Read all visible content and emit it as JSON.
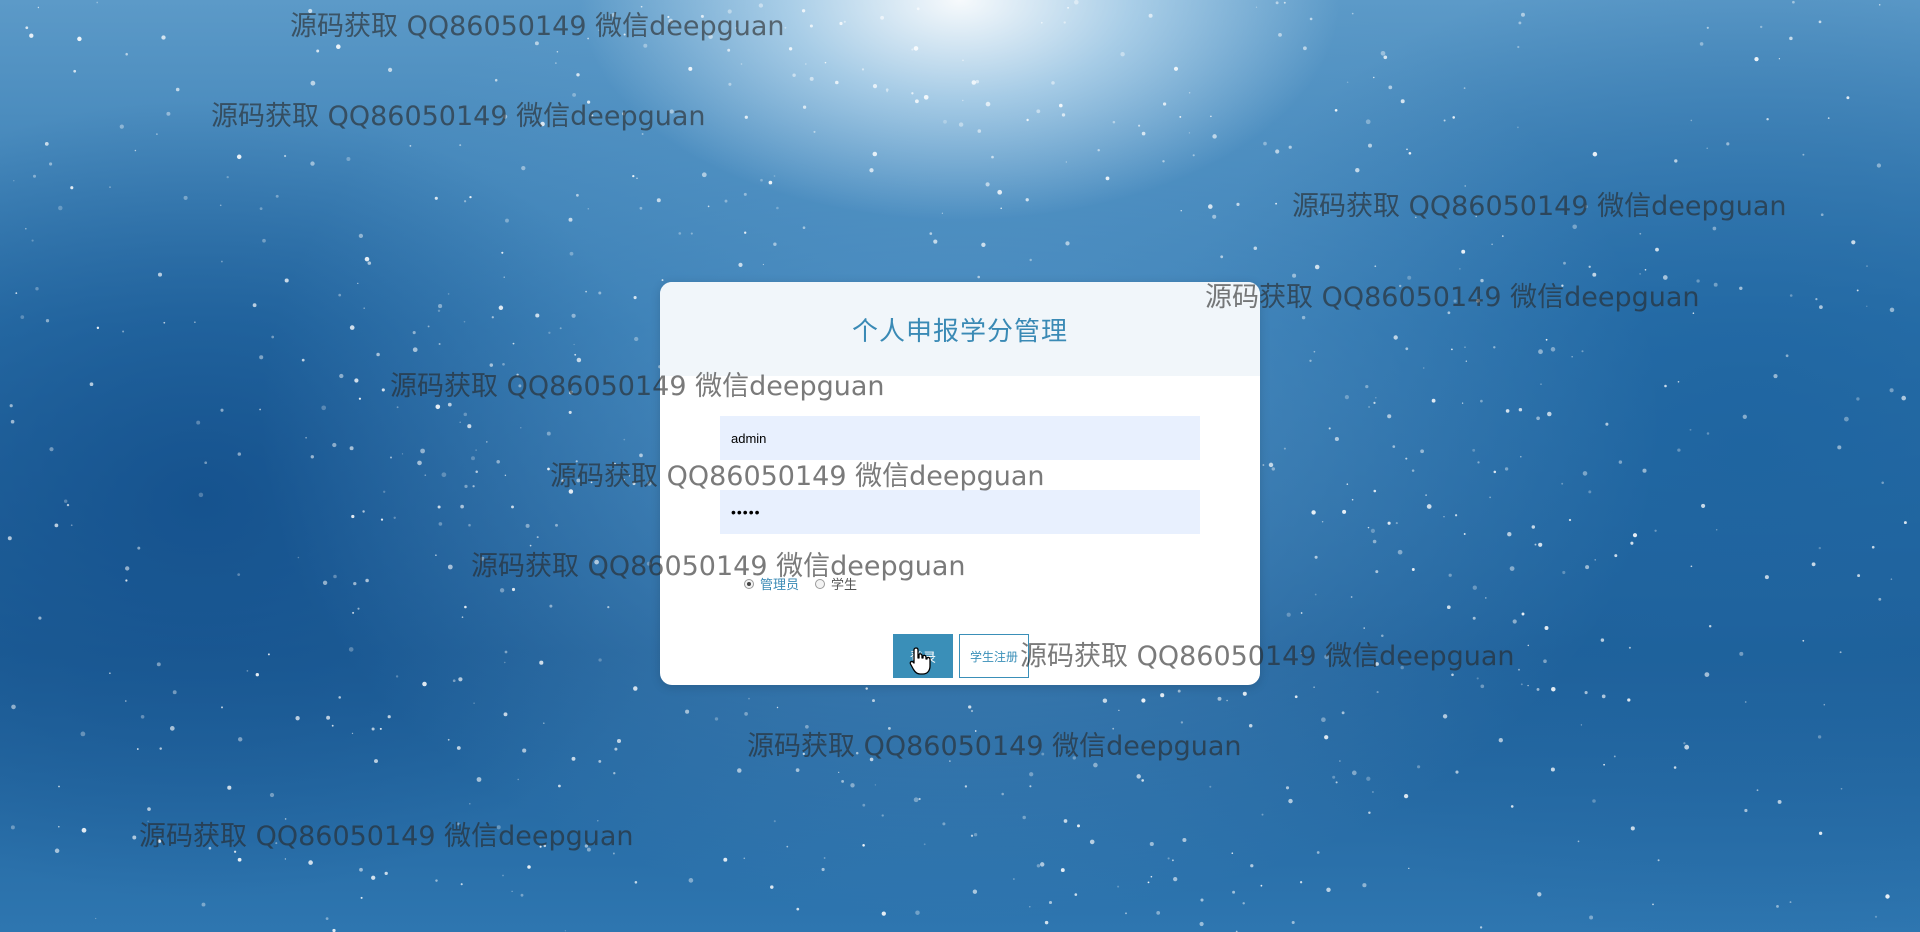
{
  "login": {
    "title": "个人申报学分管理",
    "username_value": "admin",
    "password_value": "•••••",
    "roles": [
      {
        "label": "管理员",
        "checked": true
      },
      {
        "label": "学生",
        "checked": false
      }
    ],
    "login_button": "登录",
    "register_button": "学生注册"
  },
  "watermark": {
    "text": "源码获取 QQ86050149 微信deepguan"
  },
  "colors": {
    "accent": "#3a8fb8",
    "title": "#3a8ab5",
    "input_bg": "#e8f0fe",
    "header_bg": "#f1f6fa"
  }
}
